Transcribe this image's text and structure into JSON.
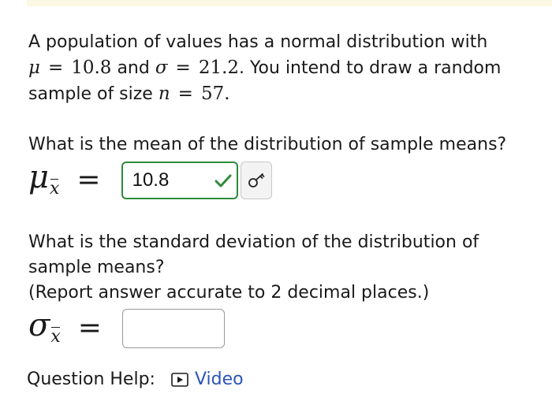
{
  "question": {
    "intro_prefix": "A population of values has a normal distribution with",
    "mu_symbol": "μ",
    "mu_value": "10.8",
    "and_text": "and",
    "sigma_symbol": "σ",
    "sigma_value": "21.2",
    "intro_suffix": ". You intend to draw a random",
    "sample_prefix": "sample of size",
    "n_symbol": "n",
    "n_value": "57",
    "period": "."
  },
  "part1": {
    "prompt": "What is the mean of the distribution of sample means?",
    "symbol": "μ",
    "subscript": "x",
    "equals": "=",
    "answer": "10.8",
    "status": "correct",
    "status_color": "#2e8b3a"
  },
  "part2": {
    "prompt_line1": "What is the standard deviation of the distribution of",
    "prompt_line2": "sample means?",
    "prompt_line3": "(Report answer accurate to 2 decimal places.)",
    "symbol": "σ",
    "subscript": "x",
    "equals": "=",
    "answer": ""
  },
  "help": {
    "label": "Question Help:",
    "video_label": "Video",
    "link_color": "#2a55b8"
  },
  "icons": {
    "check": "check-icon",
    "key": "key-icon",
    "play": "play-icon"
  }
}
